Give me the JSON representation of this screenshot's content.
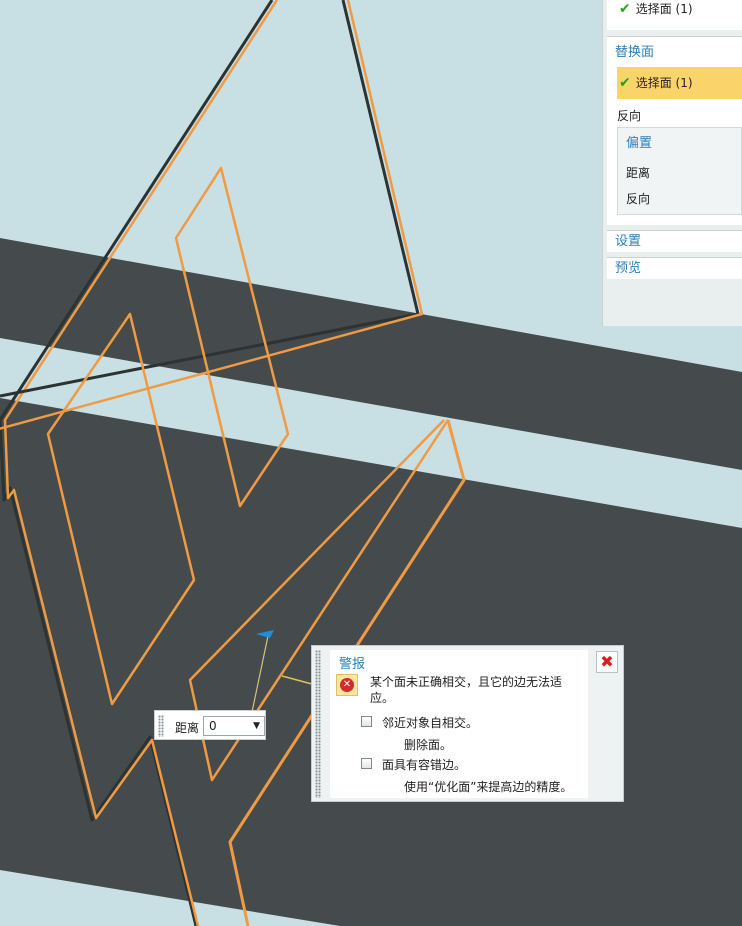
{
  "panel": {
    "top_selection": {
      "label": "选择面 (1)"
    },
    "replace_face": {
      "title": "替换面",
      "selection": "选择面 (1)",
      "reverse": "反向",
      "offset": {
        "title": "偏置",
        "distance_label": "距离",
        "reverse_label": "反向"
      }
    },
    "settings": "设置",
    "preview": "预览"
  },
  "distance_widget": {
    "label": "距离",
    "value": "0"
  },
  "alert": {
    "title": "警报",
    "message": "某个面未正确相交，且它的边无法适应。",
    "option1": {
      "label": "邻近对象自相交。",
      "hint": "删除面。"
    },
    "option2": {
      "label": "面具有容错边。",
      "hint": "使用“优化面”来提高边的精度。"
    },
    "close_icon": "close-icon"
  },
  "colors": {
    "background": "#c8dfe3",
    "dark_band": "#454b4c",
    "edge": "#f09a44",
    "highlight": "#fbd36b",
    "accent_text": "#2d7fb7"
  }
}
